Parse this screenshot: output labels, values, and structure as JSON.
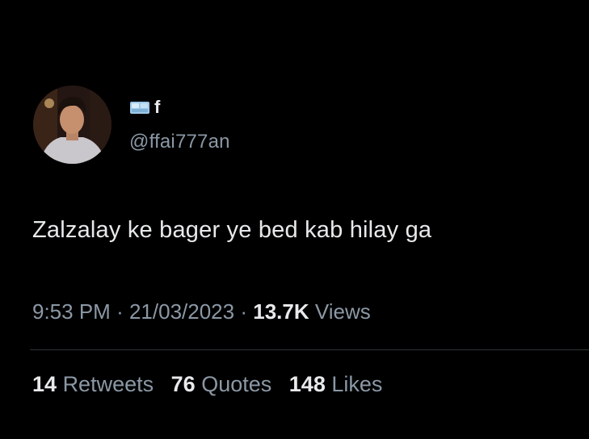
{
  "author": {
    "avatar_icon": "profile-photo",
    "emoji_icon": "ice-cube-emoji",
    "display_name": "f",
    "handle": "@ffai777an"
  },
  "tweet": {
    "text": "Zalzalay ke bager ye bed kab hilay ga",
    "time": "9:53 PM",
    "separator": "·",
    "date": "21/03/2023",
    "views_count": "13.7K",
    "views_label": "Views"
  },
  "stats": {
    "retweets_count": "14",
    "retweets_label": "Retweets",
    "quotes_count": "76",
    "quotes_label": "Quotes",
    "likes_count": "148",
    "likes_label": "Likes"
  },
  "colors": {
    "background": "#000000",
    "primary_text": "#e7e9ea",
    "secondary_text": "#8b98a5",
    "divider": "#2f3336"
  }
}
